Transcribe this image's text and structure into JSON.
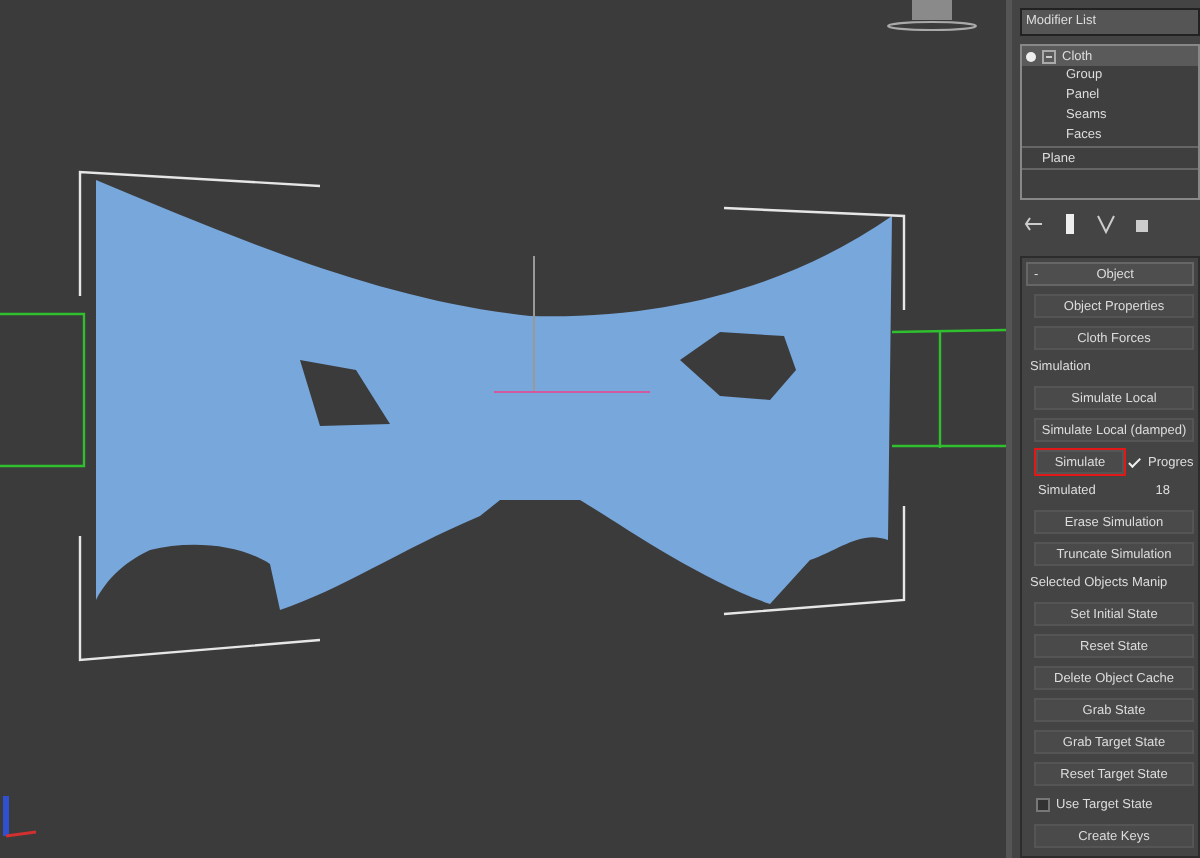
{
  "modifier_list": {
    "label": "Modifier List"
  },
  "modifier_stack": [
    {
      "label": "Cloth",
      "selected": true,
      "expanded": true,
      "children": [
        {
          "label": "Group",
          "selected": false
        },
        {
          "label": "Panel",
          "selected": false
        },
        {
          "label": "Seams",
          "selected": false
        },
        {
          "label": "Faces",
          "selected": false
        }
      ]
    },
    {
      "label": "Plane",
      "selected": false
    }
  ],
  "rollout": {
    "collapse_sign": "-",
    "title": "Object",
    "items": [
      {
        "kind": "button",
        "label": "Object Properties",
        "highlighted": false
      },
      {
        "kind": "button",
        "label": "Cloth Forces",
        "highlighted": false
      },
      {
        "kind": "group",
        "label": "Simulation"
      },
      {
        "kind": "button",
        "label": "Simulate Local",
        "highlighted": false
      },
      {
        "kind": "button",
        "label": "Simulate Local (damped)",
        "highlighted": false
      },
      {
        "kind": "button_check",
        "label": "Simulate",
        "highlighted": true,
        "check_label": "Progres",
        "checked": true
      },
      {
        "kind": "readout",
        "label": "Simulated",
        "value": "18"
      },
      {
        "kind": "button",
        "label": "Erase Simulation",
        "highlighted": false
      },
      {
        "kind": "button",
        "label": "Truncate Simulation",
        "highlighted": false
      },
      {
        "kind": "group",
        "label": "Selected Objects Manip"
      },
      {
        "kind": "button",
        "label": "Set Initial State",
        "highlighted": false
      },
      {
        "kind": "button",
        "label": "Reset State",
        "highlighted": false
      },
      {
        "kind": "button",
        "label": "Delete Object Cache",
        "highlighted": false
      },
      {
        "kind": "button",
        "label": "Grab State",
        "highlighted": false
      },
      {
        "kind": "button",
        "label": "Grab Target State",
        "highlighted": false
      },
      {
        "kind": "button",
        "label": "Reset Target State",
        "highlighted": false
      },
      {
        "kind": "checkbox",
        "label": "Use Target State",
        "checked": false
      },
      {
        "kind": "button",
        "label": "Create Keys",
        "highlighted": false
      }
    ]
  }
}
